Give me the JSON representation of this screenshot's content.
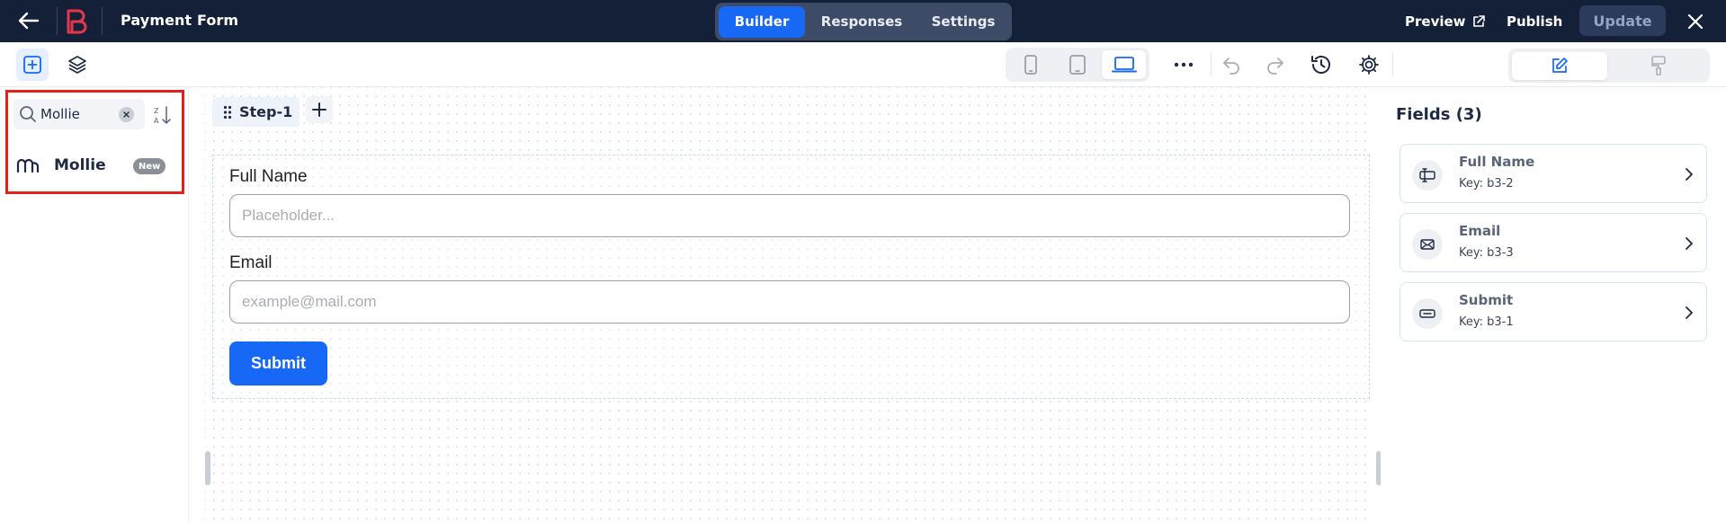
{
  "app": {
    "title": "Payment Form",
    "tabs": [
      {
        "label": "Builder",
        "active": true
      },
      {
        "label": "Responses",
        "active": false
      },
      {
        "label": "Settings",
        "active": false
      }
    ],
    "preview_label": "Preview",
    "publish_label": "Publish",
    "update_label": "Update"
  },
  "toolbar": {
    "left_icons": [
      "add-block-icon",
      "layers-icon"
    ],
    "devices": [
      {
        "icon": "mobile-icon",
        "active": false
      },
      {
        "icon": "tablet-icon",
        "active": false
      },
      {
        "icon": "desktop-icon",
        "active": true
      }
    ],
    "actions": [
      "more-icon",
      "undo-icon",
      "redo-icon",
      "history-icon",
      "gear-icon"
    ],
    "mode_toggle": [
      {
        "icon": "edit-icon",
        "active": true
      },
      {
        "icon": "paint-brush-icon",
        "active": false
      }
    ]
  },
  "left_panel": {
    "search": {
      "value": "Mollie",
      "placeholder": ""
    },
    "results": [
      {
        "label": "Mollie",
        "badge": "New",
        "icon": "mollie-icon"
      }
    ]
  },
  "canvas": {
    "steps": [
      {
        "label": "Step-1",
        "active": true
      }
    ],
    "form": {
      "fields": [
        {
          "label": "Full Name",
          "placeholder": "Placeholder..."
        },
        {
          "label": "Email",
          "placeholder": "example@mail.com"
        }
      ],
      "submit_label": "Submit"
    }
  },
  "right_panel": {
    "title": "Fields (3)",
    "fields": [
      {
        "name": "Full Name",
        "key": "Key: b3-2",
        "icon": "text-field-icon"
      },
      {
        "name": "Email",
        "key": "Key: b3-3",
        "icon": "email-icon"
      },
      {
        "name": "Submit",
        "key": "Key: b3-1",
        "icon": "button-icon"
      }
    ]
  },
  "colors": {
    "topbar": "#142038",
    "accent": "#1668f5",
    "highlight": "#e3211b",
    "logo": "#e6374a"
  }
}
